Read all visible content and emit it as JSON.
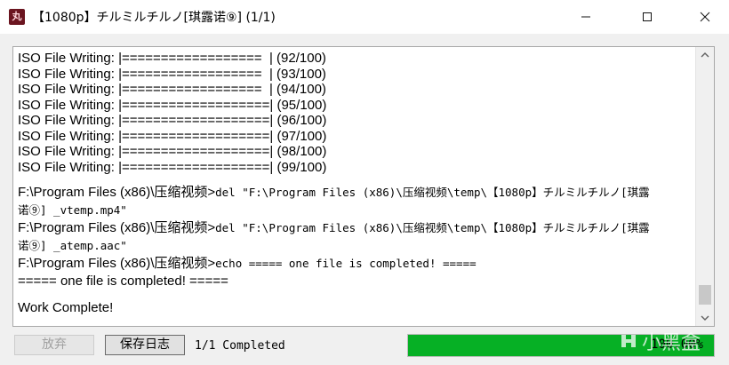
{
  "window": {
    "app_icon_glyph": "丸",
    "title": "【1080p】チルミルチルノ[琪露诺⑨]  (1/1)"
  },
  "console": {
    "progress_lines": [
      "ISO File Writing: |==================  | (92/100)",
      "ISO File Writing: |==================  | (93/100)",
      "ISO File Writing: |==================  | (94/100)",
      "ISO File Writing: |===================| (95/100)",
      "ISO File Writing: |===================| (96/100)",
      "ISO File Writing: |===================| (97/100)",
      "ISO File Writing: |===================| (98/100)",
      "ISO File Writing: |===================| (99/100)"
    ],
    "prompt": "F:\\Program Files (x86)\\压缩视频>",
    "cmd1_a": "del \"F:\\Program Files (x86)\\压缩视频\\temp\\【1080p】チルミルチルノ[琪露",
    "cmd1_b": "诺⑨] _vtemp.mp4\"",
    "cmd2_a": "del \"F:\\Program Files (x86)\\压缩视频\\temp\\【1080p】チルミルチルノ[琪露",
    "cmd2_b": "诺⑨] _atemp.aac\"",
    "cmd3": "echo ===== one file is completed! =====",
    "echo_out": "===== one file is completed! =====",
    "work_complete": "Work Complete!"
  },
  "bottom": {
    "abandon_label": "放弃",
    "save_log_label": "保存日志",
    "status": "1/1 Completed",
    "progress_percent": 100,
    "progress_text": "100.00%",
    "watermark": "小黑盒"
  },
  "colors": {
    "progress_fill": "#06b025"
  }
}
